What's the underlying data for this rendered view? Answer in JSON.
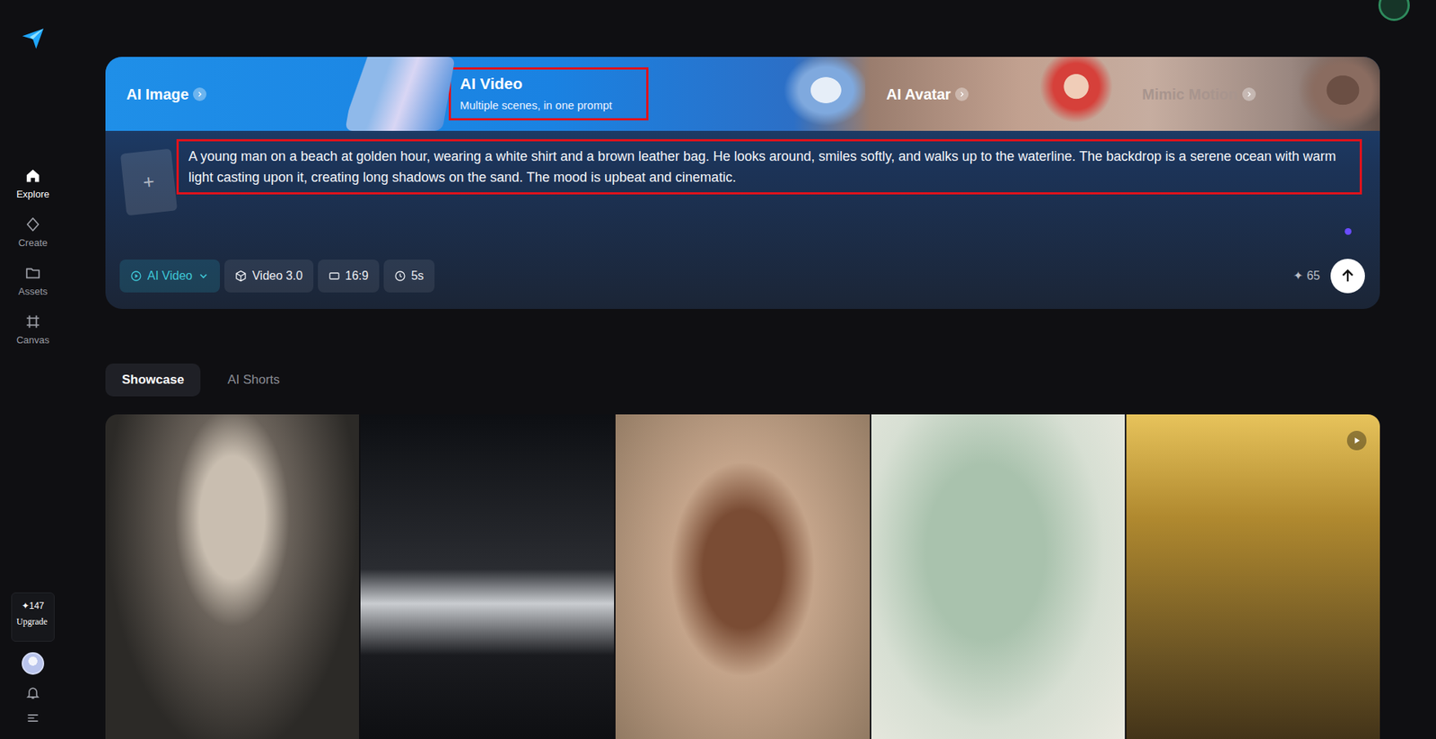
{
  "sidebar": {
    "items": [
      {
        "label": "Explore",
        "selected": true
      },
      {
        "label": "Create",
        "selected": false
      },
      {
        "label": "Assets",
        "selected": false
      },
      {
        "label": "Canvas",
        "selected": false
      }
    ]
  },
  "credits": {
    "icon": "✦",
    "amount": "147",
    "action": "Upgrade"
  },
  "hero": {
    "tabs": [
      {
        "label": "AI Image",
        "selected": false,
        "disabled": false
      },
      {
        "label": "AI Video",
        "subtitle": "Multiple scenes, in one prompt",
        "selected": true,
        "disabled": false
      },
      {
        "label": "AI Avatar",
        "selected": false,
        "disabled": false
      },
      {
        "label": "Mimic Motion",
        "selected": false,
        "disabled": true
      }
    ],
    "upload_icon": "+",
    "prompt": {
      "text": "A young man on a beach at golden hour, wearing a white shirt and a brown leather bag. He looks around, smiles softly, and walks up to the waterline. The backdrop is a serene ocean with warm light casting upon it, creating long shadows on the sand. The mood is upbeat and cinematic.",
      "highlighted": true
    },
    "options": [
      {
        "label": "AI Video",
        "kind": "mode",
        "selected": true
      },
      {
        "label": "Video 3.0",
        "kind": "model",
        "selected": false
      },
      {
        "label": "16:9",
        "kind": "ratio",
        "selected": false
      },
      {
        "label": "5s",
        "kind": "duration",
        "selected": false
      }
    ],
    "cost": {
      "icon": "✦",
      "amount": "65"
    }
  },
  "content_tabs": [
    {
      "label": "Showcase",
      "selected": true
    },
    {
      "label": "AI Shorts",
      "selected": false
    }
  ],
  "gallery": [
    {
      "kind": "image"
    },
    {
      "kind": "image"
    },
    {
      "kind": "image"
    },
    {
      "kind": "image"
    },
    {
      "kind": "video"
    }
  ]
}
